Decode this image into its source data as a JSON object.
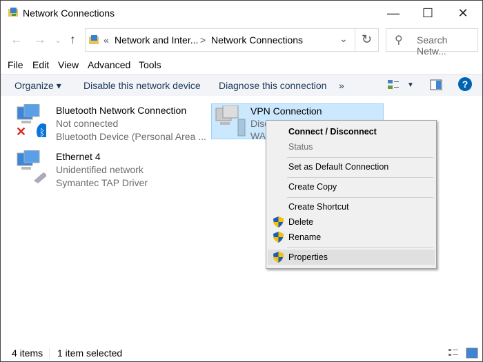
{
  "window": {
    "title": "Network Connections",
    "minimize": "—",
    "maximize": "☐",
    "close": "✕"
  },
  "address": {
    "prefix": "«",
    "crumb1": "Network and Inter...",
    "sep": ">",
    "crumb2": "Network Connections",
    "dropdown": "⌄",
    "refresh": "↻"
  },
  "search": {
    "placeholder": "Search Netw..."
  },
  "menubar": [
    "File",
    "Edit",
    "View",
    "Advanced",
    "Tools"
  ],
  "toolbar": {
    "organize": "Organize ▾",
    "disable": "Disable this network device",
    "diagnose": "Diagnose this connection",
    "more": "»",
    "help": "?"
  },
  "items": [
    {
      "name": "Bluetooth Network Connection",
      "status": "Not connected",
      "device": "Bluetooth Device (Personal Area ..."
    },
    {
      "name": "VPN Connection",
      "status": "Disc",
      "device": "WA"
    },
    {
      "name": "Ethernet 4",
      "status": "Unidentified network",
      "device": "Symantec TAP Driver"
    }
  ],
  "context_menu": [
    {
      "label": "Connect / Disconnect",
      "bold": true
    },
    {
      "label": "Status",
      "disabled": true
    },
    {
      "label": "Set as Default Connection"
    },
    {
      "label": "Create Copy"
    },
    {
      "label": "Create Shortcut"
    },
    {
      "label": "Delete",
      "shield": true
    },
    {
      "label": "Rename",
      "shield": true
    },
    {
      "label": "Properties",
      "shield": true,
      "highlighted": true
    }
  ],
  "statusbar": {
    "count": "4 items",
    "selected": "1 item selected"
  },
  "colors": {
    "selection": "#cce8ff",
    "accent": "#0063b1"
  }
}
